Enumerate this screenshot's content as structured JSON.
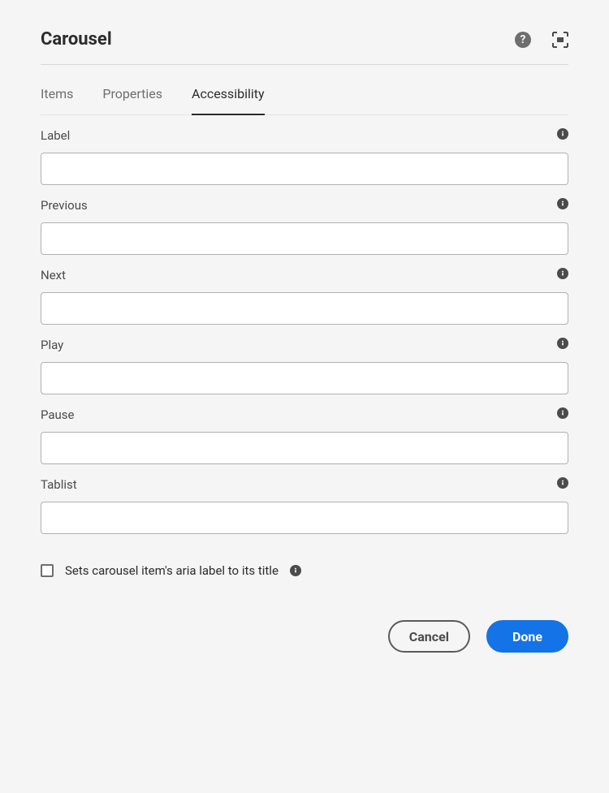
{
  "header": {
    "title": "Carousel"
  },
  "tabs": [
    {
      "label": "Items",
      "active": false
    },
    {
      "label": "Properties",
      "active": false
    },
    {
      "label": "Accessibility",
      "active": true
    }
  ],
  "fields": {
    "label": {
      "label": "Label",
      "value": ""
    },
    "previous": {
      "label": "Previous",
      "value": ""
    },
    "next": {
      "label": "Next",
      "value": ""
    },
    "play": {
      "label": "Play",
      "value": ""
    },
    "pause": {
      "label": "Pause",
      "value": ""
    },
    "tablist": {
      "label": "Tablist",
      "value": ""
    }
  },
  "checkbox": {
    "label": "Sets carousel item's aria label to its title",
    "checked": false
  },
  "footer": {
    "cancel": "Cancel",
    "done": "Done"
  }
}
